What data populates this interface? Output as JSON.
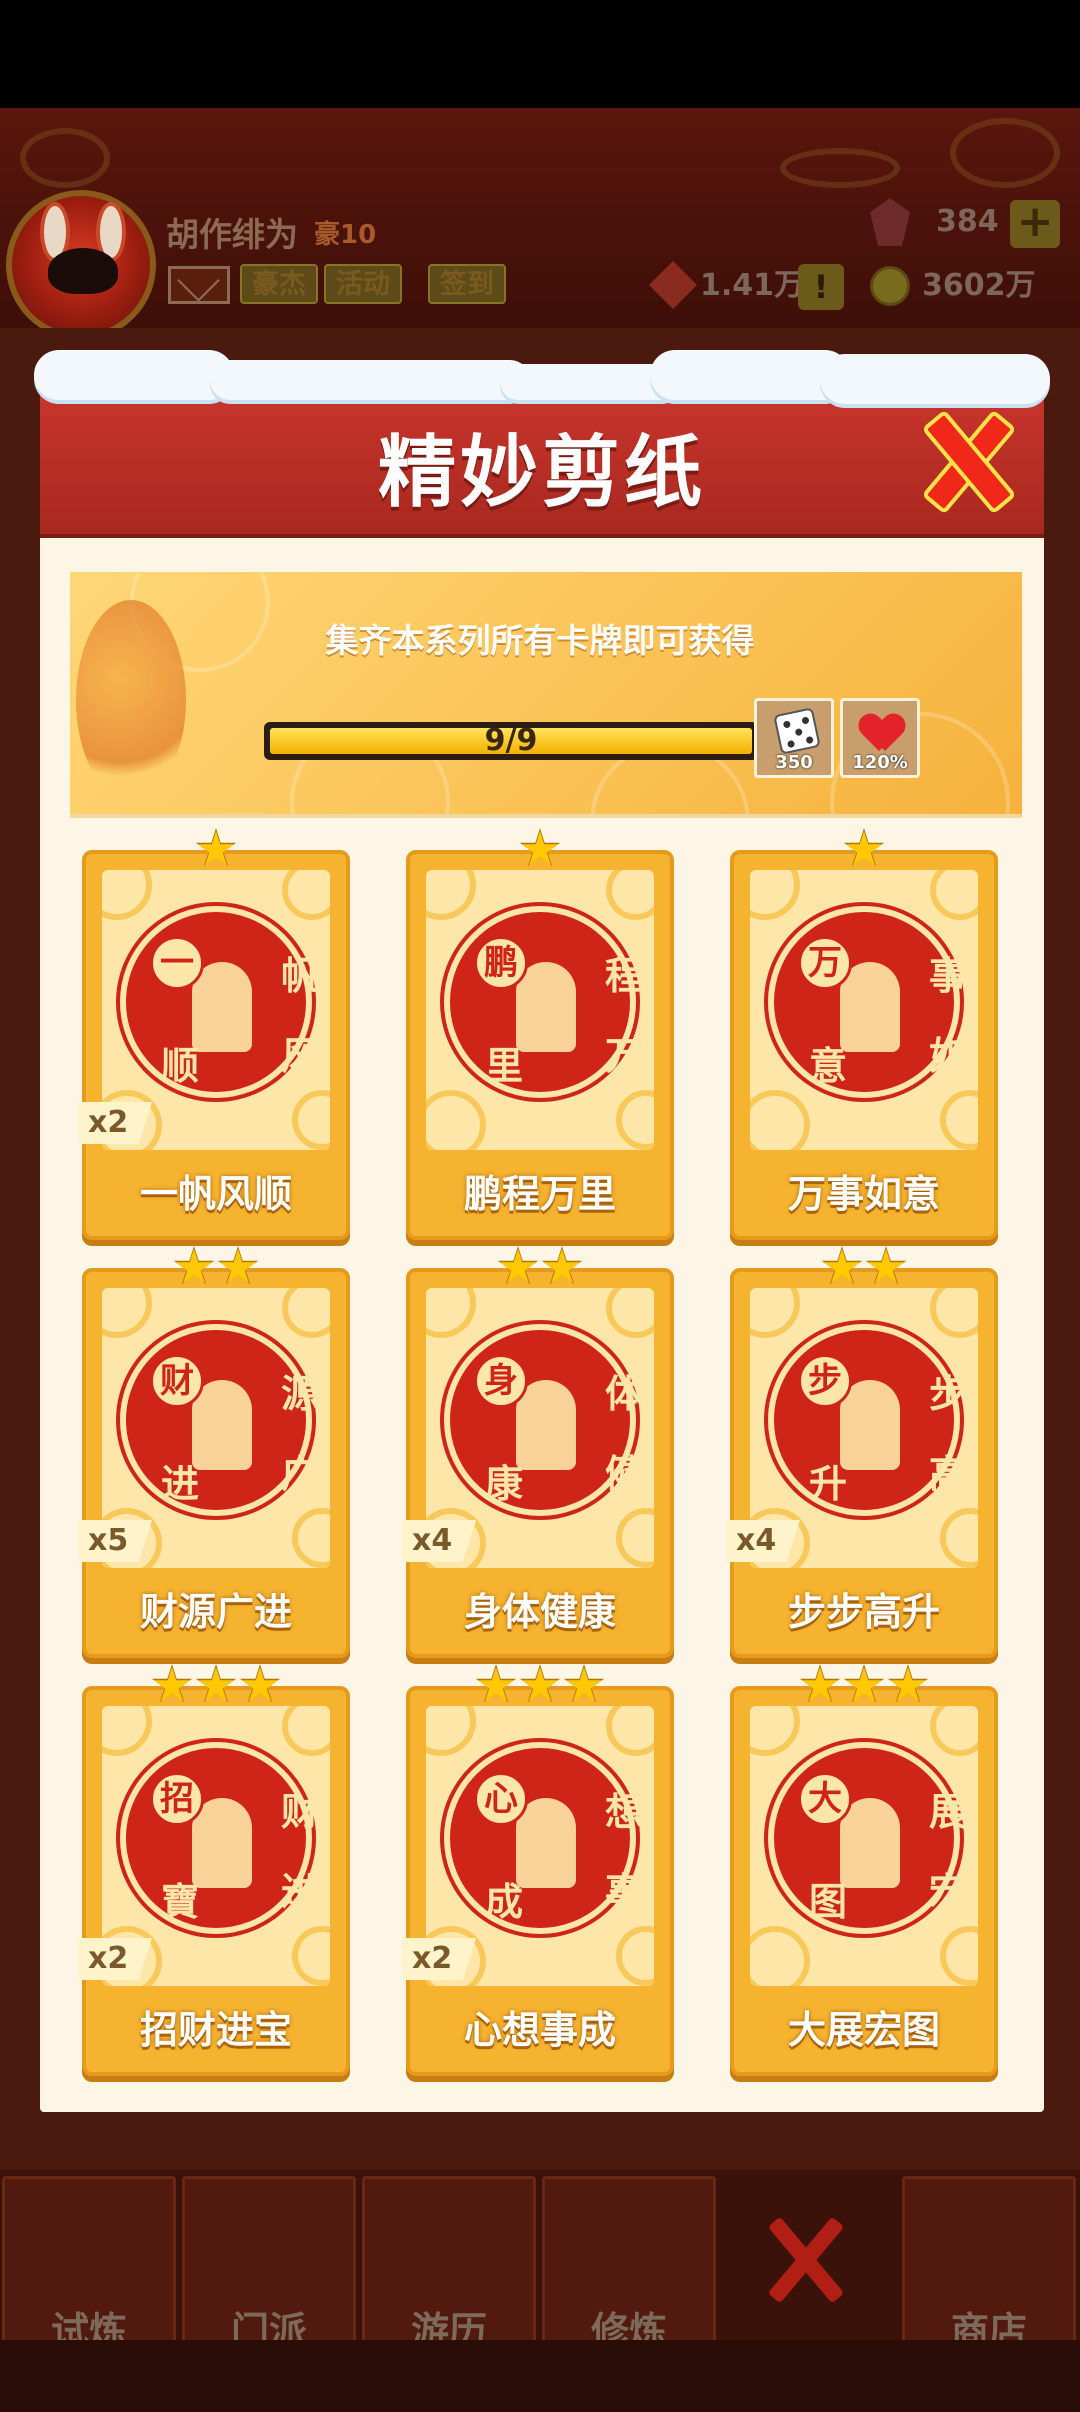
{
  "player": {
    "name": "胡作绯为",
    "rank": "豪10"
  },
  "header_tags": [
    "豪杰",
    "活动",
    "签到"
  ],
  "resources": {
    "gems": "384",
    "chips": "1.41万",
    "coins": "3602万"
  },
  "modal": {
    "title": "精妙剪纸",
    "banner_text": "集齐本系列所有卡牌即可获得",
    "progress_text": "9/9",
    "progress_fraction": 1.0,
    "rewards": [
      {
        "icon": "dice-icon",
        "label": "350"
      },
      {
        "icon": "heart-icon",
        "label": "120%"
      }
    ]
  },
  "cards": [
    {
      "name": "一帆风顺",
      "stars": 1,
      "count": "x2",
      "chars": [
        "一",
        "帆",
        "风",
        "顺"
      ]
    },
    {
      "name": "鹏程万里",
      "stars": 1,
      "count": "",
      "chars": [
        "鹏",
        "程",
        "万",
        "里"
      ]
    },
    {
      "name": "万事如意",
      "stars": 1,
      "count": "",
      "chars": [
        "万",
        "事",
        "如",
        "意"
      ]
    },
    {
      "name": "财源广进",
      "stars": 2,
      "count": "x5",
      "chars": [
        "财",
        "源",
        "广",
        "进"
      ]
    },
    {
      "name": "身体健康",
      "stars": 2,
      "count": "x4",
      "chars": [
        "身",
        "体",
        "健",
        "康"
      ]
    },
    {
      "name": "步步高升",
      "stars": 2,
      "count": "x4",
      "chars": [
        "步",
        "步",
        "高",
        "升"
      ]
    },
    {
      "name": "招财进宝",
      "stars": 3,
      "count": "x2",
      "chars": [
        "招",
        "财",
        "进",
        "寶"
      ]
    },
    {
      "name": "心想事成",
      "stars": 3,
      "count": "x2",
      "chars": [
        "心",
        "想",
        "事",
        "成"
      ]
    },
    {
      "name": "大展宏图",
      "stars": 3,
      "count": "",
      "chars": [
        "大",
        "展",
        "宏",
        "图"
      ]
    }
  ],
  "nav": [
    {
      "label": "试炼"
    },
    {
      "label": "门派"
    },
    {
      "label": "游历"
    },
    {
      "label": "修炼"
    },
    {
      "label": "商店"
    }
  ],
  "colors": {
    "modal_header": "#c8352c",
    "card_gold": "#f6b32f",
    "papercut_red": "#cf2418",
    "close_red": "#f1271a"
  }
}
